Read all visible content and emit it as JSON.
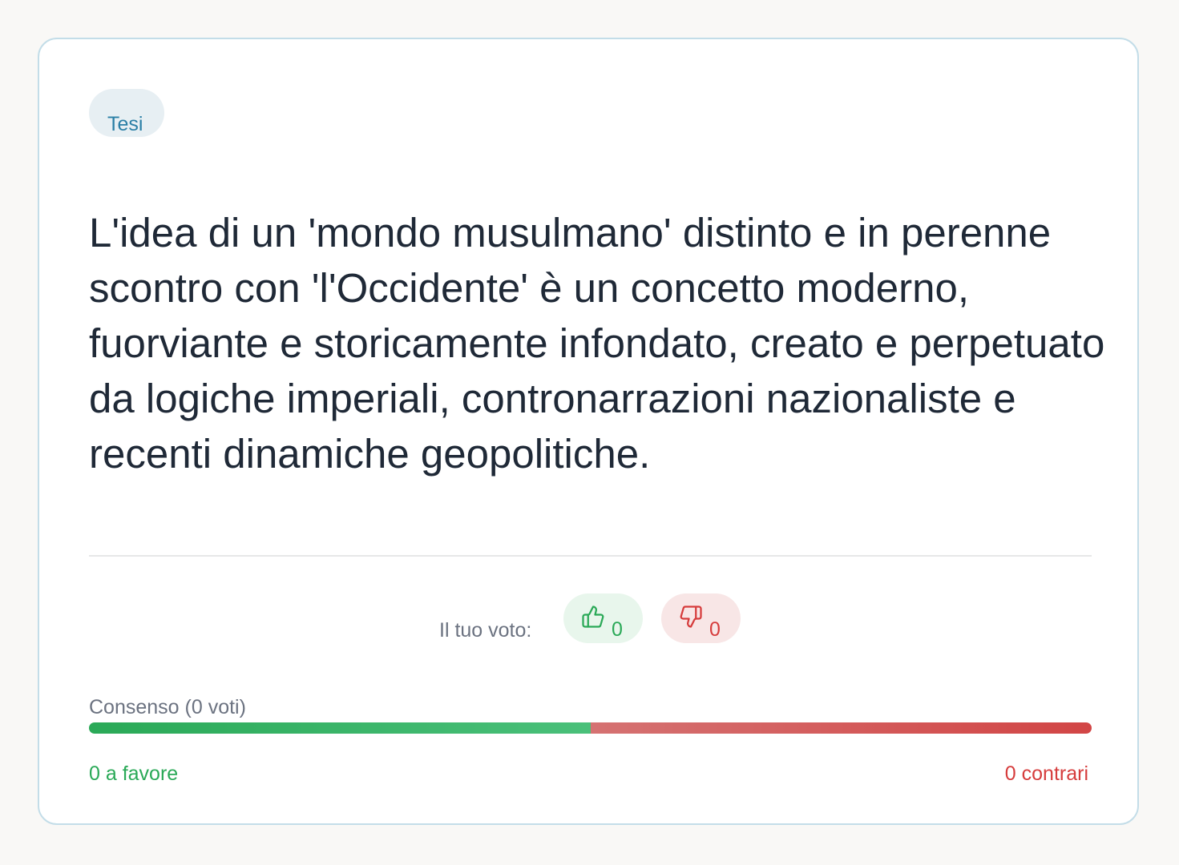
{
  "card": {
    "tag_label": "Tesi",
    "statement": "L'idea di un 'mondo musulmano' distinto e in perenne scontro con 'l'Occidente' è un concetto moderno, fuorviante e storicamente infondato, creato e perpetuato da logiche imperiali, contronarrazioni nazionaliste e recenti dinamiche geopolitiche."
  },
  "vote": {
    "label": "Il tuo voto:",
    "up_icon": "thumbs-up-icon",
    "up_count": "0",
    "down_icon": "thumbs-down-icon",
    "down_count": "0"
  },
  "consensus": {
    "label": "Consenso (0 voti)",
    "for_share": 0.5,
    "against_share": 0.5,
    "for_text": "0 a favore",
    "against_text": "0 contrari"
  },
  "colors": {
    "accent_blue": "#2a7fa6",
    "positive": "#2aa957",
    "negative": "#d63c3c"
  }
}
